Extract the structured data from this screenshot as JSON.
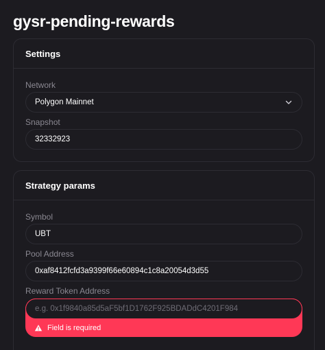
{
  "page": {
    "title": "gysr-pending-rewards"
  },
  "settings": {
    "header": "Settings",
    "network": {
      "label": "Network",
      "value": "Polygon Mainnet"
    },
    "snapshot": {
      "label": "Snapshot",
      "value": "32332923"
    }
  },
  "strategy": {
    "header": "Strategy params",
    "symbol": {
      "label": "Symbol",
      "value": "UBT"
    },
    "pool_address": {
      "label": "Pool Address",
      "value": "0xaf8412fcfd3a9399f66e60894c1c8a20054d3d55"
    },
    "reward_token": {
      "label": "Reward Token Address",
      "placeholder": "e.g. 0x1f9840a85d5aF5bf1D1762F925BDADdC4201F984",
      "error": "Field is required"
    }
  },
  "colors": {
    "background": "#1c1b20",
    "border": "#2d2c33",
    "muted": "#8a8891",
    "error": "#ff3856"
  },
  "icons": {
    "select": "chevron-down-icon",
    "error": "warning-icon"
  }
}
